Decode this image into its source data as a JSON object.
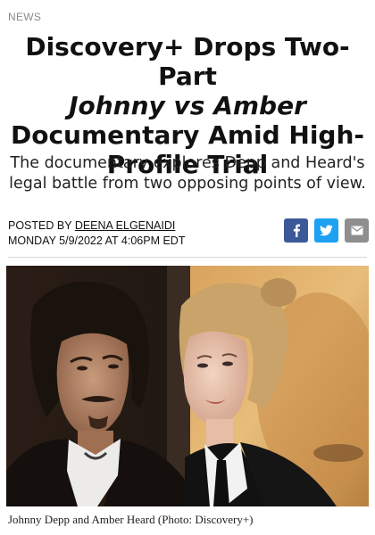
{
  "article": {
    "section": "NEWS",
    "headline_line1": "Discovery+ Drops Two-Part",
    "headline_italic": "Johnny vs Amber",
    "headline_line3": "Documentary Amid High-Profile Trial",
    "dek": "The documentary explores Depp and Heard's legal battle from two opposing points of view.",
    "posted_by_label": "POSTED BY",
    "author": "DEENA ELGENAIDI",
    "date": "MONDAY 5/9/2022 AT 4:06PM EDT"
  },
  "share": {
    "icons": [
      "facebook-icon",
      "twitter-icon",
      "email-icon"
    ],
    "facebook_color": "#3b5998",
    "twitter_color": "#1da1f2",
    "email_color": "#8e8e8e"
  },
  "photo": {
    "caption": "Johnny Depp and Amber Heard (Photo: Discovery+)"
  }
}
